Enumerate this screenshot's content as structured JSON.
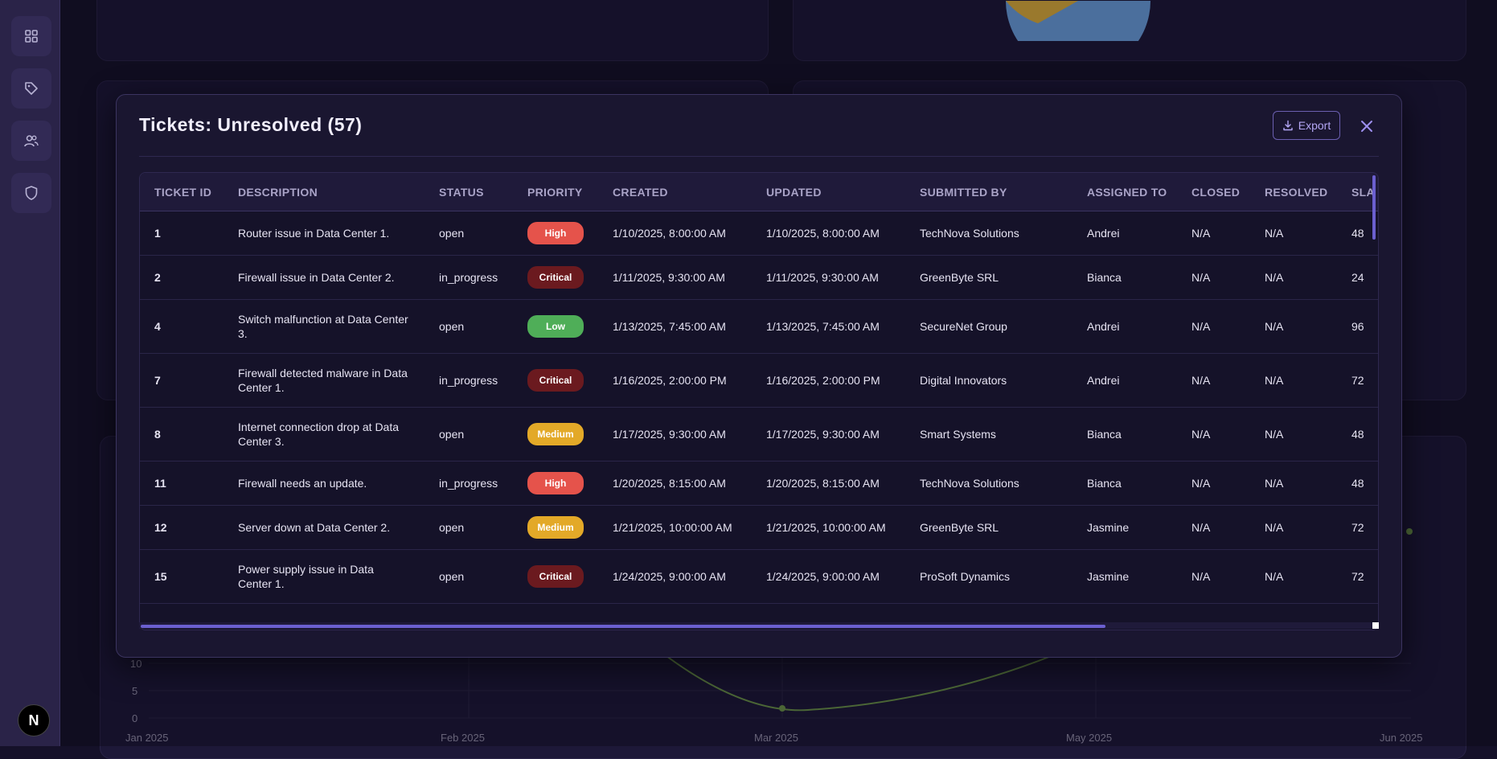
{
  "sidebar": {
    "icons": [
      "grid-icon",
      "tag-icon",
      "users-icon",
      "shield-icon"
    ],
    "badge": "N"
  },
  "background_chart": {
    "y_ticks": [
      "10",
      "5",
      "0"
    ],
    "x_ticks": [
      "Jan 2025",
      "Feb 2025",
      "Mar 2025",
      "May 2025",
      "Jun 2025"
    ]
  },
  "modal": {
    "title": "Tickets: Unresolved (57)",
    "export_label": "Export",
    "columns": [
      "TICKET ID",
      "DESCRIPTION",
      "STATUS",
      "PRIORITY",
      "CREATED",
      "UPDATED",
      "SUBMITTED BY",
      "ASSIGNED TO",
      "CLOSED",
      "RESOLVED",
      "SLA"
    ],
    "rows": [
      {
        "id": "1",
        "description": "Router issue in Data Center 1.",
        "status": "open",
        "priority": "High",
        "created": "1/10/2025, 8:00:00 AM",
        "updated": "1/10/2025, 8:00:00 AM",
        "submitted_by": "TechNova Solutions",
        "assigned_to": "Andrei",
        "closed": "N/A",
        "resolved": "N/A",
        "sla": "48"
      },
      {
        "id": "2",
        "description": "Firewall issue in Data Center 2.",
        "status": "in_progress",
        "priority": "Critical",
        "created": "1/11/2025, 9:30:00 AM",
        "updated": "1/11/2025, 9:30:00 AM",
        "submitted_by": "GreenByte SRL",
        "assigned_to": "Bianca",
        "closed": "N/A",
        "resolved": "N/A",
        "sla": "24"
      },
      {
        "id": "4",
        "description": "Switch malfunction at Data Center 3.",
        "status": "open",
        "priority": "Low",
        "created": "1/13/2025, 7:45:00 AM",
        "updated": "1/13/2025, 7:45:00 AM",
        "submitted_by": "SecureNet Group",
        "assigned_to": "Andrei",
        "closed": "N/A",
        "resolved": "N/A",
        "sla": "96"
      },
      {
        "id": "7",
        "description": "Firewall detected malware in Data Center 1.",
        "status": "in_progress",
        "priority": "Critical",
        "created": "1/16/2025, 2:00:00 PM",
        "updated": "1/16/2025, 2:00:00 PM",
        "submitted_by": "Digital Innovators",
        "assigned_to": "Andrei",
        "closed": "N/A",
        "resolved": "N/A",
        "sla": "72"
      },
      {
        "id": "8",
        "description": "Internet connection drop at Data Center 3.",
        "status": "open",
        "priority": "Medium",
        "created": "1/17/2025, 9:30:00 AM",
        "updated": "1/17/2025, 9:30:00 AM",
        "submitted_by": "Smart Systems",
        "assigned_to": "Bianca",
        "closed": "N/A",
        "resolved": "N/A",
        "sla": "48"
      },
      {
        "id": "11",
        "description": "Firewall needs an update.",
        "status": "in_progress",
        "priority": "High",
        "created": "1/20/2025, 8:15:00 AM",
        "updated": "1/20/2025, 8:15:00 AM",
        "submitted_by": "TechNova Solutions",
        "assigned_to": "Bianca",
        "closed": "N/A",
        "resolved": "N/A",
        "sla": "48"
      },
      {
        "id": "12",
        "description": "Server down at Data Center 2.",
        "status": "open",
        "priority": "Medium",
        "created": "1/21/2025, 10:00:00 AM",
        "updated": "1/21/2025, 10:00:00 AM",
        "submitted_by": "GreenByte SRL",
        "assigned_to": "Jasmine",
        "closed": "N/A",
        "resolved": "N/A",
        "sla": "72"
      },
      {
        "id": "15",
        "description": "Power supply issue in Data Center 1.",
        "status": "open",
        "priority": "Critical",
        "created": "1/24/2025, 9:00:00 AM",
        "updated": "1/24/2025, 9:00:00 AM",
        "submitted_by": "ProSoft Dynamics",
        "assigned_to": "Jasmine",
        "closed": "N/A",
        "resolved": "N/A",
        "sla": "72"
      }
    ]
  }
}
